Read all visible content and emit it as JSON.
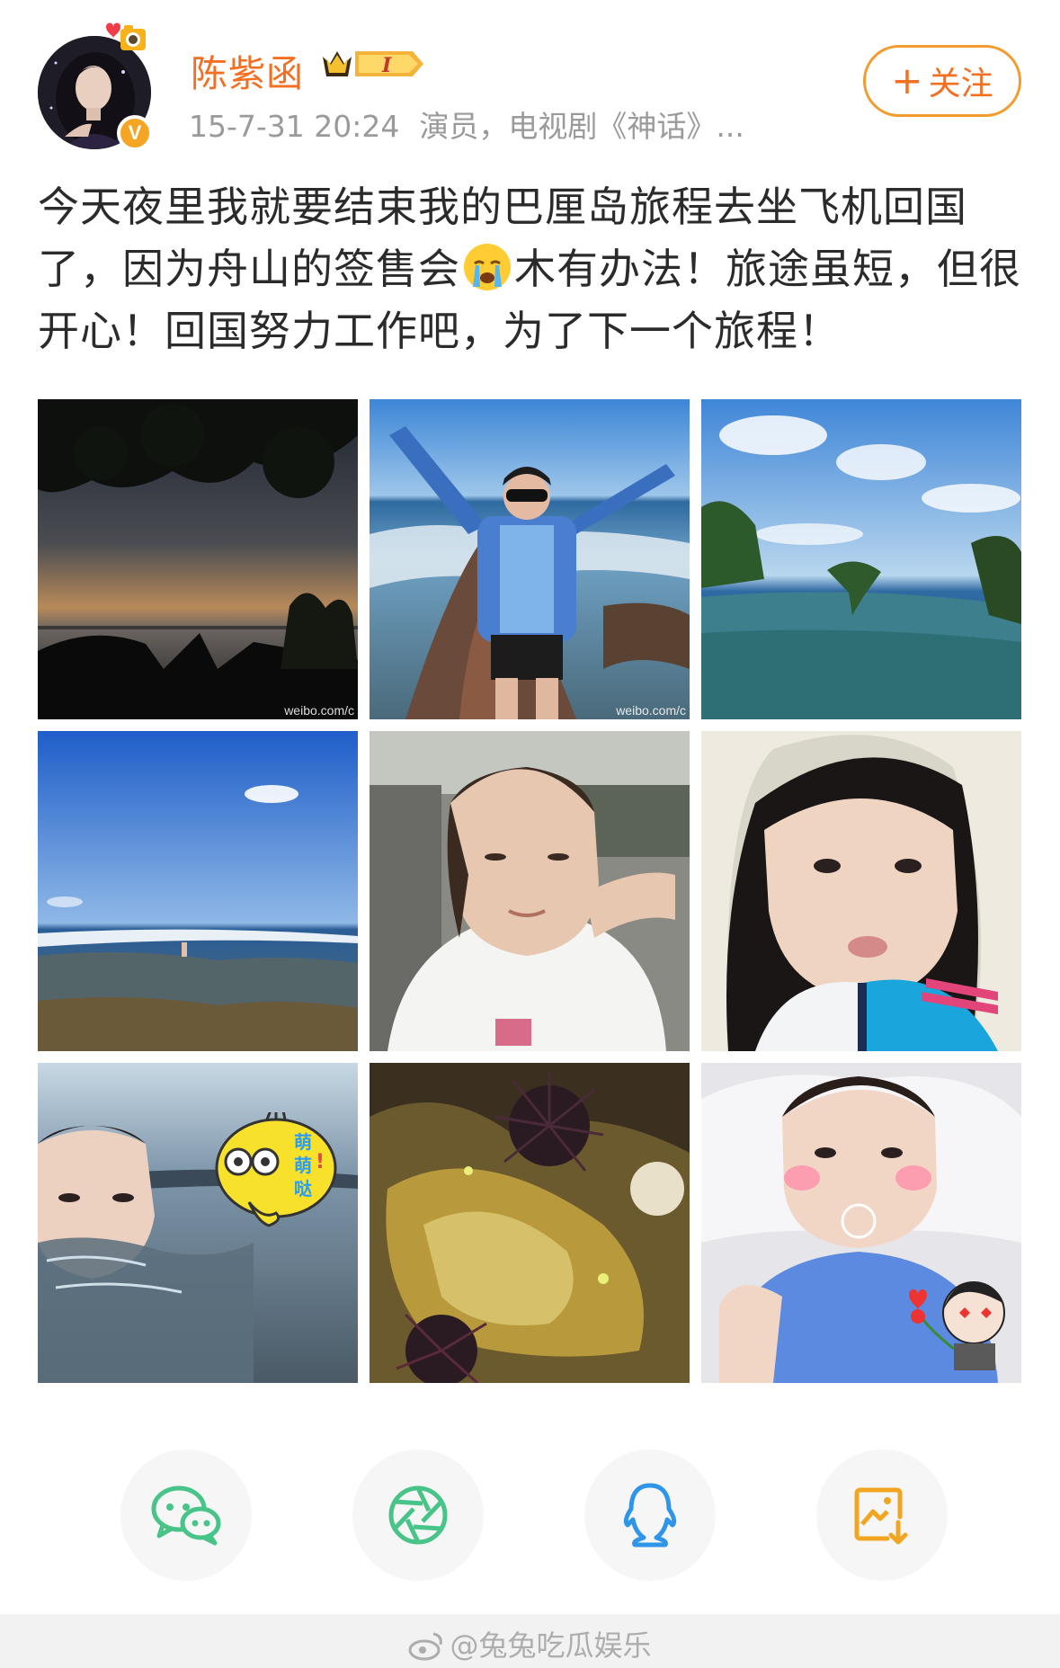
{
  "post": {
    "author": {
      "name": "陈紫函",
      "verified_badge": "V",
      "avatar_icon": "avatar-portrait"
    },
    "meta": {
      "time": "15-7-31 20:24",
      "source": "演员，电视剧《神话》..."
    },
    "follow_label": "关注",
    "follow_plus": "+",
    "text_before_emoji": "今天夜里我就要结束我的巴厘岛旅程去坐飞机回国了，因为舟山的签售会",
    "emoji": "crying-face-emoji",
    "text_after_emoji": "木有办法！旅途虽短，但很开心！回国努力工作吧，为了下一个旅程！",
    "photos": [
      {
        "kind": "dusk-sea-silhouette",
        "watermark": "weibo.com/c"
      },
      {
        "kind": "woman-arms-raised-on-reef",
        "watermark": "weibo.com/c"
      },
      {
        "kind": "infinity-pool-ocean"
      },
      {
        "kind": "blue-sky-rocky-shore"
      },
      {
        "kind": "car-selfie-white-tee"
      },
      {
        "kind": "sunhat-selfie-blue-jacket"
      },
      {
        "kind": "swimming-pool-with-sticker",
        "sticker_text": "萌萌哒"
      },
      {
        "kind": "sea-urchins-tidepool"
      },
      {
        "kind": "pillow-selfie-with-sticker"
      }
    ]
  },
  "share": {
    "buttons": [
      {
        "icon": "wechat-icon"
      },
      {
        "icon": "moments-icon"
      },
      {
        "icon": "qq-icon"
      },
      {
        "icon": "save-image-icon"
      }
    ]
  },
  "footer": {
    "watermark": "@兔兔吃瓜娱乐"
  },
  "colors": {
    "accent": "#f36f21",
    "follow_border": "#f39b2d",
    "meta": "#9a9a9a",
    "text": "#2b2b2b"
  }
}
